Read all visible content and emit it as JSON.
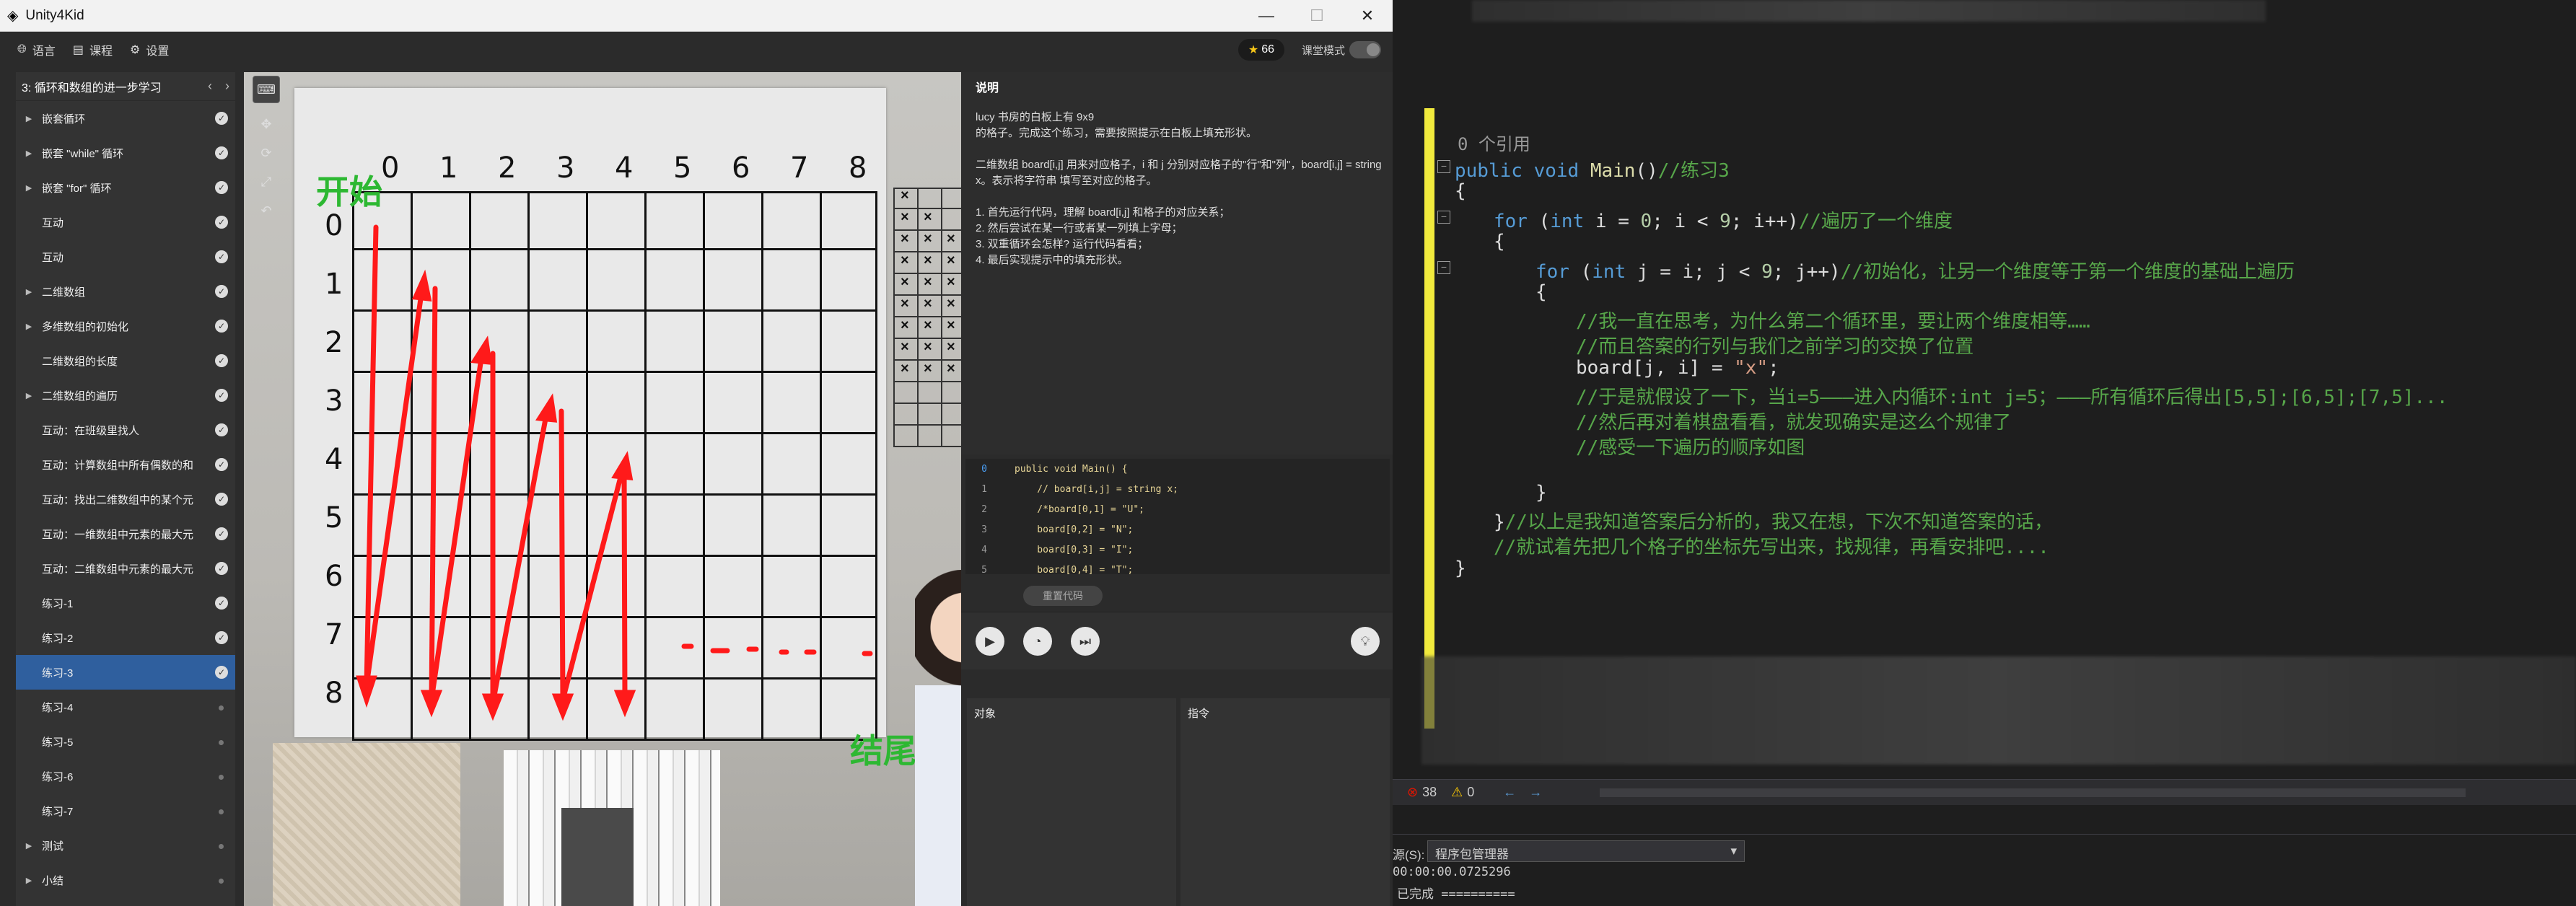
{
  "app": {
    "title": "Unity4Kid",
    "stars": "66",
    "class_mode": "课堂模式"
  },
  "topbar": {
    "language": "语言",
    "course": "课程",
    "settings": "设置"
  },
  "sidebar": {
    "header": "3: 循环和数组的进一步学习",
    "items": [
      {
        "label": "嵌套循环",
        "arrow": true,
        "state": "done"
      },
      {
        "label": "嵌套 \"while\" 循环",
        "arrow": true,
        "state": "done"
      },
      {
        "label": "嵌套 \"for\" 循环",
        "arrow": true,
        "state": "done"
      },
      {
        "label": "互动",
        "arrow": false,
        "state": "done"
      },
      {
        "label": "互动",
        "arrow": false,
        "state": "done"
      },
      {
        "label": "二维数组",
        "arrow": true,
        "state": "done"
      },
      {
        "label": "多维数组的初始化",
        "arrow": true,
        "state": "done"
      },
      {
        "label": "二维数组的长度",
        "arrow": false,
        "state": "done"
      },
      {
        "label": "二维数组的遍历",
        "arrow": true,
        "state": "done"
      },
      {
        "label": "互动：在班级里找人",
        "arrow": false,
        "state": "done"
      },
      {
        "label": "互动：计算数组中所有偶数的和",
        "arrow": false,
        "state": "done"
      },
      {
        "label": "互动：找出二维数组中的某个元",
        "arrow": false,
        "state": "done"
      },
      {
        "label": "互动：一维数组中元素的最大元",
        "arrow": false,
        "state": "done"
      },
      {
        "label": "互动：二维数组中元素的最大元",
        "arrow": false,
        "state": "done"
      },
      {
        "label": "练习-1",
        "arrow": false,
        "state": "done"
      },
      {
        "label": "练习-2",
        "arrow": false,
        "state": "done"
      },
      {
        "label": "练习-3",
        "arrow": false,
        "state": "selected"
      },
      {
        "label": "练习-4",
        "arrow": false,
        "state": "todo"
      },
      {
        "label": "练习-5",
        "arrow": false,
        "state": "todo"
      },
      {
        "label": "练习-6",
        "arrow": false,
        "state": "todo"
      },
      {
        "label": "练习-7",
        "arrow": false,
        "state": "todo"
      },
      {
        "label": "测试",
        "arrow": true,
        "state": "todo"
      },
      {
        "label": "小结",
        "arrow": true,
        "state": "todo"
      }
    ]
  },
  "scene": {
    "col_numbers": [
      "0",
      "1",
      "2",
      "3",
      "4",
      "5",
      "6",
      "7",
      "8"
    ],
    "row_numbers": [
      "0",
      "1",
      "2",
      "3",
      "4",
      "5",
      "6",
      "7",
      "8"
    ],
    "start_label": "开始",
    "end_label": "结尾"
  },
  "description": {
    "title": "说明",
    "text": "lucy 书房的白板上有 9x9\n的格子。完成这个练习，需要按照提示在白板上填充形状。\n\n二维数组 board[i,j] 用来对应格子，i 和 j 分别对应格子的\"行\"和\"列\"，board[i,j] = string x。表示将字符串 填写至对应的格子。\n\n1. 首先运行代码，理解 board[i,j] 和格子的对应关系；\n2. 然后尝试在某一行或者某一列填上字母；\n3. 双重循环会怎样? 运行代码看看；\n4. 最后实现提示中的填充形状。"
  },
  "code": {
    "lines": [
      {
        "n": "0",
        "text": "public void Main() {"
      },
      {
        "n": "1",
        "text": "    // board[i,j] = string x;"
      },
      {
        "n": "2",
        "text": "    /*board[0,1] = \"U\";"
      },
      {
        "n": "3",
        "text": "    board[0,2] = \"N\";"
      },
      {
        "n": "4",
        "text": "    board[0,3] = \"I\";"
      },
      {
        "n": "5",
        "text": "    board[0,4] = \"T\";"
      }
    ],
    "reset_label": "重置代码"
  },
  "panes": {
    "objects": "对象",
    "instructions": "指令"
  },
  "vs": {
    "ref_count": "0 个引用",
    "errors": "38",
    "warnings": "0",
    "source_label": "源(S):",
    "source_value": "程序包管理器",
    "out_time": "00:00:00.0725296",
    "out_done": "已完成 =========="
  },
  "colors": {
    "accent": "#2f5f9e",
    "highlight": "#f1ea3d",
    "arrow_red": "#ff1a1a",
    "label_green": "#2db832"
  }
}
